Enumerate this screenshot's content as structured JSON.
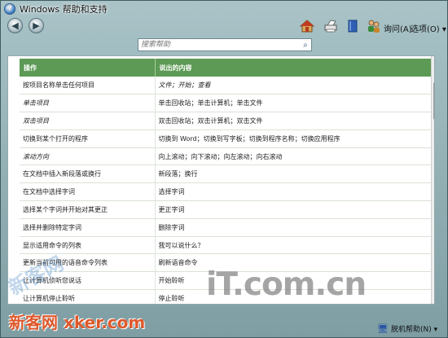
{
  "window": {
    "title": "Windows 帮助和支持",
    "app_icon_glyph": "?"
  },
  "toolbar": {
    "back_glyph": "◀",
    "forward_glyph": "▶",
    "icons": [
      "home-icon",
      "print-icon",
      "browse-help-icon",
      "ask-people-icon"
    ],
    "ask_label": "询问(A)",
    "options_label": "选项(O) ▾"
  },
  "search": {
    "placeholder": "搜索帮助",
    "button_glyph": "⌕"
  },
  "table": {
    "headers": [
      "操作",
      "说出的内容"
    ],
    "rows": [
      {
        "action": "按项目名称单击任何项目",
        "say": "文件；开始；查看",
        "action_italic": false,
        "say_italic": true
      },
      {
        "action": "单击项目",
        "say": "单击回收站；单击计算机；单击文件",
        "action_italic": true,
        "say_italic": false
      },
      {
        "action": "双击项目",
        "say": "双击回收站；双击计算机；双击文件",
        "action_italic": true,
        "say_italic": false
      },
      {
        "action": "切换到某个打开的程序",
        "say": "切换到 Word；切换到写字板；切换到程序名称；切换应用程序",
        "action_italic": false,
        "say_italic": false
      },
      {
        "action": "滚动方向",
        "say": "向上滚动；向下滚动；向左滚动；向右滚动",
        "action_italic": true,
        "say_italic": false
      },
      {
        "action": "在文档中插入新段落或换行",
        "say": "新段落；换行",
        "action_italic": false,
        "say_italic": false
      },
      {
        "action": "在文档中选择字词",
        "say": "选择字词",
        "action_italic": false,
        "say_italic": false
      },
      {
        "action": "选择某个字词并开始对其更正",
        "say": "更正字词",
        "action_italic": false,
        "say_italic": false
      },
      {
        "action": "选择并删除特定字词",
        "say": "删除字词",
        "action_italic": false,
        "say_italic": false
      },
      {
        "action": "显示适用命令的列表",
        "say": "我可以说什么？",
        "action_italic": false,
        "say_italic": false
      },
      {
        "action": "更新当前可用的语音命令列表",
        "say": "刷新语音命令",
        "action_italic": false,
        "say_italic": false
      },
      {
        "action": "让计算机侦听您说话",
        "say": "开始聆听",
        "action_italic": false,
        "say_italic": false
      },
      {
        "action": "让计算机停止聆听",
        "say": "停止聆听",
        "action_italic": false,
        "say_italic": false
      }
    ]
  },
  "statusbar": {
    "offline_label": "脱机帮助(N) ▾"
  },
  "watermarks": {
    "brand": "iT.com.cn",
    "site": "新客网 xker.com",
    "diagonal": "新客网"
  }
}
